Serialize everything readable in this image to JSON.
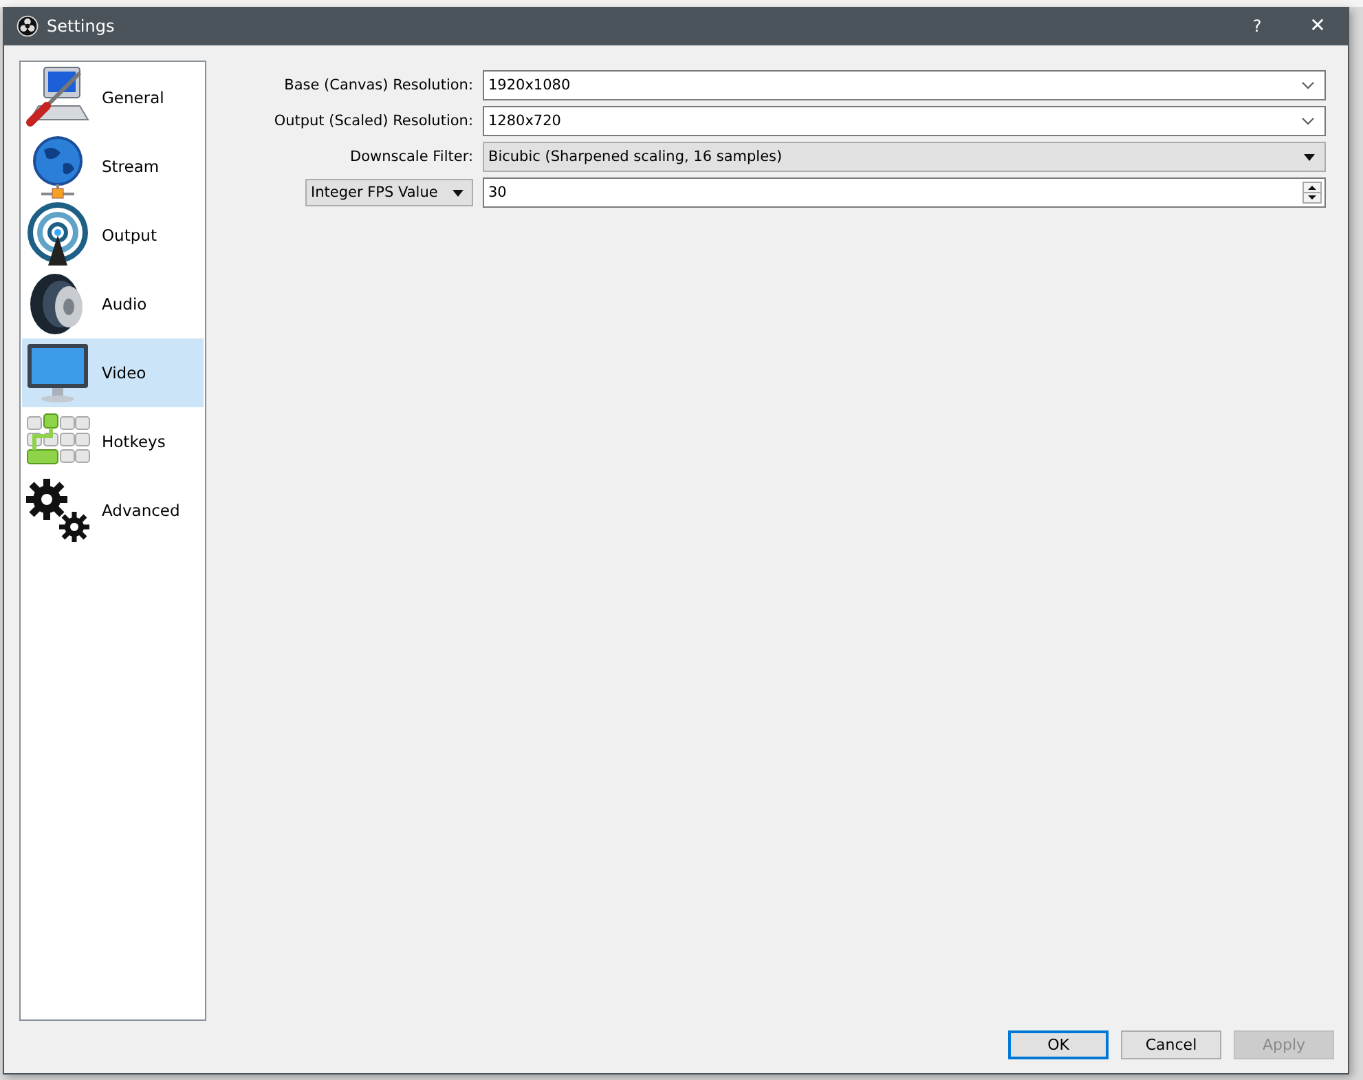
{
  "window": {
    "title": "Settings",
    "help": "?",
    "close": "✕"
  },
  "sidebar": {
    "items": [
      {
        "label": "General",
        "kind": "general",
        "selected": false
      },
      {
        "label": "Stream",
        "kind": "stream",
        "selected": false
      },
      {
        "label": "Output",
        "kind": "output",
        "selected": false
      },
      {
        "label": "Audio",
        "kind": "audio",
        "selected": false
      },
      {
        "label": "Video",
        "kind": "video",
        "selected": true
      },
      {
        "label": "Hotkeys",
        "kind": "hotkeys",
        "selected": false
      },
      {
        "label": "Advanced",
        "kind": "advanced",
        "selected": false
      }
    ]
  },
  "form": {
    "rows": [
      {
        "label": {
          "kind": "text",
          "text": "Base (Canvas) Resolution:"
        },
        "field": {
          "kind": "editable",
          "value": "1920x1080"
        }
      },
      {
        "label": {
          "kind": "text",
          "text": "Output (Scaled) Resolution:"
        },
        "field": {
          "kind": "editable",
          "value": "1280x720"
        }
      },
      {
        "label": {
          "kind": "text",
          "text": "Downscale Filter:"
        },
        "field": {
          "kind": "dropdown",
          "value": "Bicubic (Sharpened scaling, 16 samples)"
        }
      },
      {
        "label": {
          "kind": "dropdown",
          "text": "Integer FPS Value"
        },
        "field": {
          "kind": "spin",
          "value": "30"
        }
      }
    ]
  },
  "buttons": [
    {
      "label": "OK",
      "default": true,
      "disabled": false
    },
    {
      "label": "Cancel",
      "default": false,
      "disabled": false
    },
    {
      "label": "Apply",
      "default": false,
      "disabled": true
    }
  ]
}
